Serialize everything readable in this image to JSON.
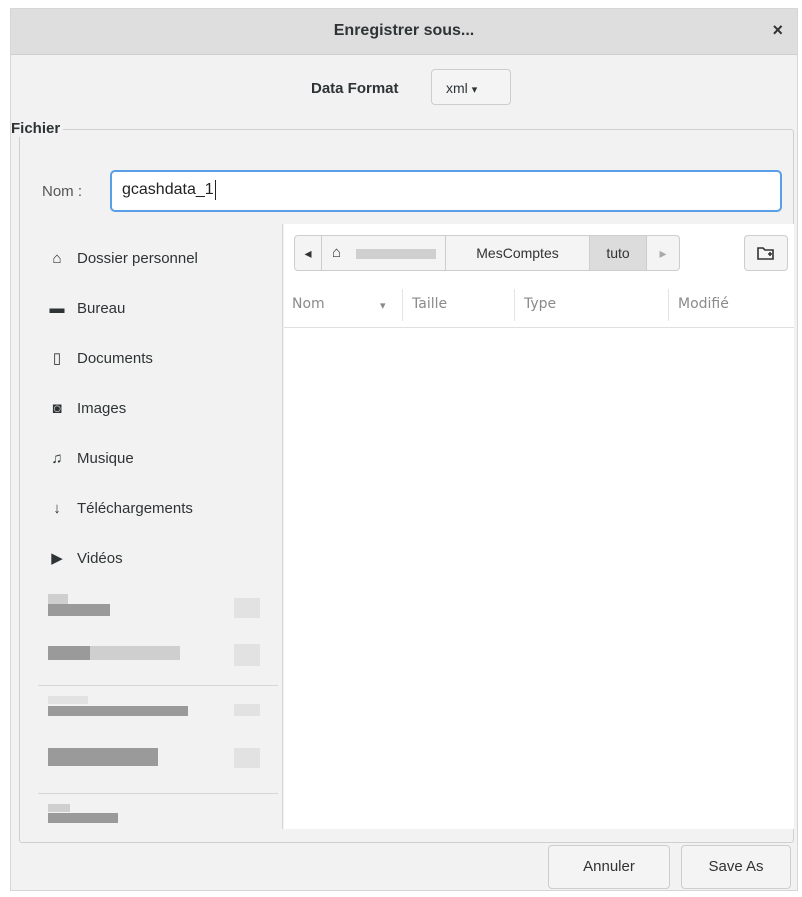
{
  "dialog": {
    "title": "Enregistrer sous...",
    "close_glyph": "×"
  },
  "format": {
    "label": "Data Format",
    "selected": "xml",
    "arrow_glyph": "▾"
  },
  "section": {
    "legend": "Fichier"
  },
  "name_field": {
    "label": "Nom :",
    "value": "gcashdata_1"
  },
  "sidebar": {
    "items": [
      {
        "label": "Dossier personnel",
        "icon": "home-icon",
        "glyph": "⌂"
      },
      {
        "label": "Bureau",
        "icon": "folder-icon",
        "glyph": "▬"
      },
      {
        "label": "Documents",
        "icon": "document-icon",
        "glyph": "▯"
      },
      {
        "label": "Images",
        "icon": "camera-icon",
        "glyph": "◙"
      },
      {
        "label": "Musique",
        "icon": "music-icon",
        "glyph": "♫"
      },
      {
        "label": "Téléchargements",
        "icon": "download-arrow-icon",
        "glyph": "↓"
      },
      {
        "label": "Vidéos",
        "icon": "video-icon",
        "glyph": "▶"
      }
    ]
  },
  "pathbar": {
    "left_glyph": "◂",
    "home_glyph": "⌂",
    "segments": [
      "MesComptes",
      "tuto"
    ],
    "right_glyph": "▸"
  },
  "columns": {
    "name": "Nom",
    "size": "Taille",
    "type": "Type",
    "modified": "Modifié",
    "sort_glyph": "▾"
  },
  "buttons": {
    "cancel": "Annuler",
    "save": "Save As"
  },
  "colors": {
    "accent": "#5a9ee6",
    "titlebar": "#dedede",
    "window_bg": "#f2f2f2",
    "selected_crumb": "#dcdcdc"
  }
}
